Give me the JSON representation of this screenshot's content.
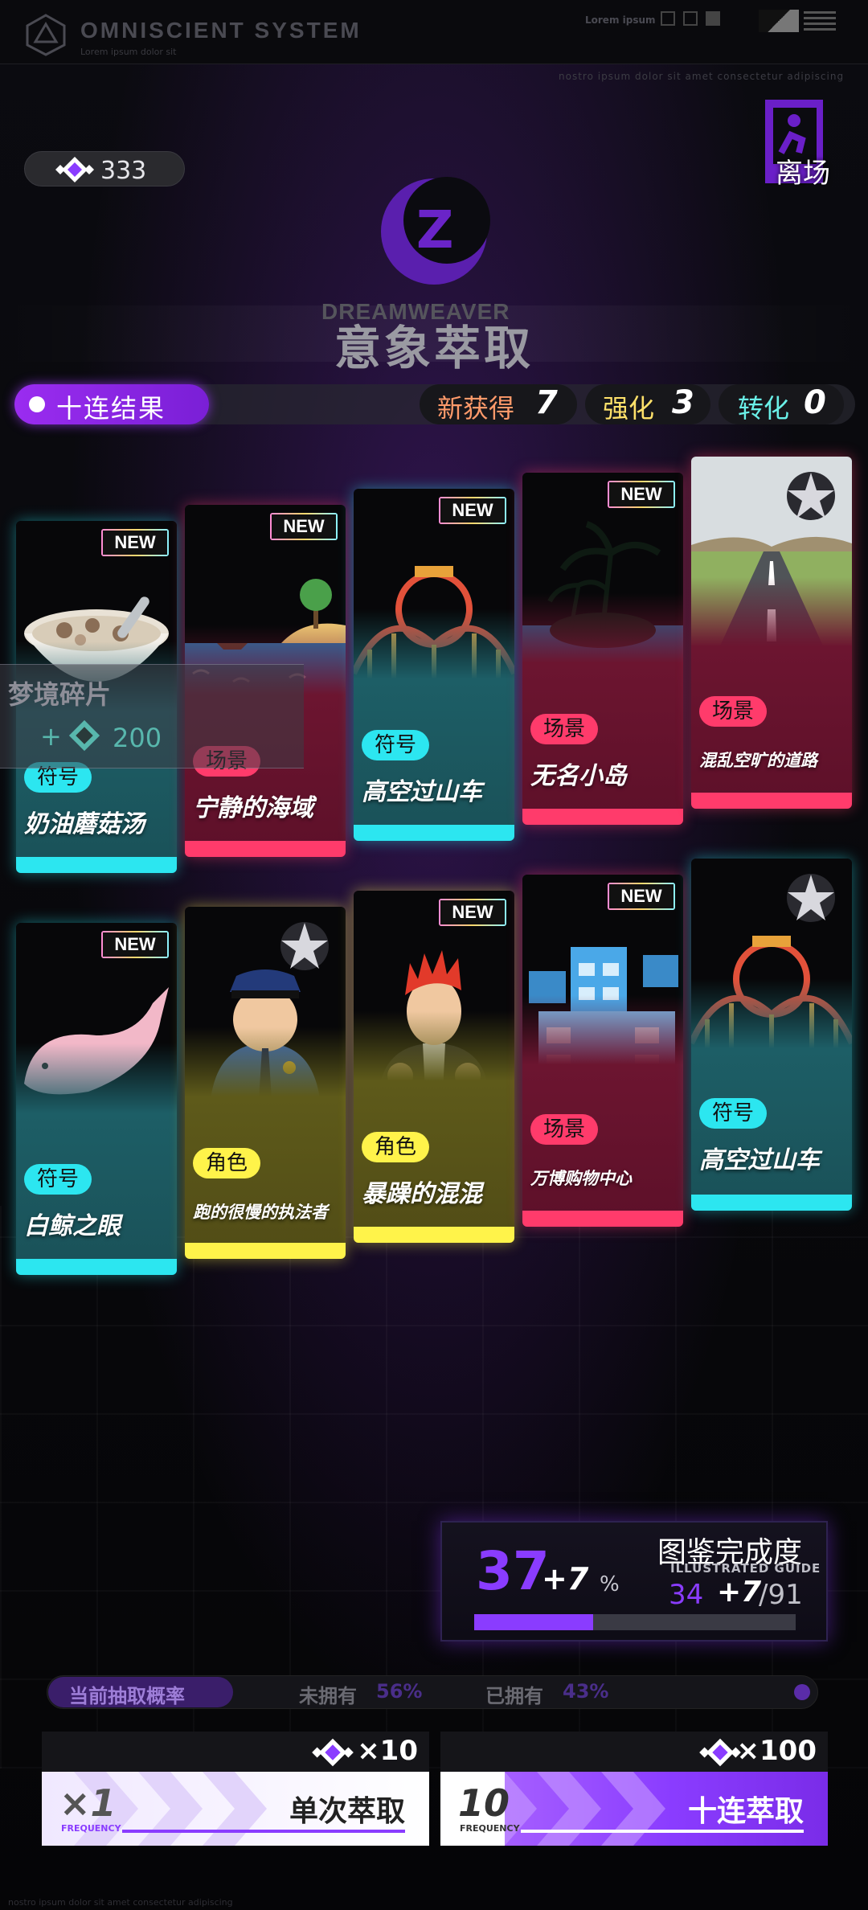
{
  "system": {
    "title": "OMNISCIENT  SYSTEM",
    "subtitle": "Lorem ipsum dolor sit",
    "lorem": "Lorem ipsum",
    "ticker": "nostro ipsum dolor sit amet consectetur adipiscing"
  },
  "currency": {
    "amount": "333",
    "icon": "dream-crystal-icon"
  },
  "exit": {
    "label": "离场",
    "icon": "exit-door-icon"
  },
  "emblem": {
    "brand": "DREAMWEAVER",
    "title": "意象萃取"
  },
  "results": {
    "label": "十连结果",
    "stats": [
      {
        "label": "新获得",
        "value": "7",
        "color": "#ff9a6a"
      },
      {
        "label": "强化",
        "value": "3",
        "color": "#ffe16a"
      },
      {
        "label": "转化",
        "value": "0",
        "color": "#6af0e8"
      }
    ]
  },
  "cards": [
    {
      "name": "奶油蘑菇汤",
      "tag": "符号",
      "theme": "teal",
      "badge": "NEW",
      "art": "mushroom-soup"
    },
    {
      "name": "宁静的海域",
      "tag": "场景",
      "theme": "red",
      "badge": "NEW",
      "art": "calm-sea"
    },
    {
      "name": "高空过山车",
      "tag": "符号",
      "theme": "teal",
      "badge": "NEW",
      "art": "roller-coaster"
    },
    {
      "name": "无名小岛",
      "tag": "场景",
      "theme": "red",
      "badge": "NEW",
      "art": "nameless-island"
    },
    {
      "name": "混乱空旷的道路",
      "tag": "场景",
      "theme": "red",
      "badge": "star",
      "art": "empty-road"
    },
    {
      "name": "白鲸之眼",
      "tag": "符号",
      "theme": "teal",
      "badge": "NEW",
      "art": "white-whale"
    },
    {
      "name": "跑的很慢的执法者",
      "tag": "角色",
      "theme": "yellow",
      "badge": "star",
      "art": "police-officer"
    },
    {
      "name": "暴躁的混混",
      "tag": "角色",
      "theme": "yellow",
      "badge": "NEW",
      "art": "punk"
    },
    {
      "name": "万博购物中心",
      "tag": "场景",
      "theme": "red",
      "badge": "NEW",
      "art": "shopping-mall"
    },
    {
      "name": "高空过山车",
      "tag": "符号",
      "theme": "teal",
      "badge": "star",
      "art": "roller-coaster"
    }
  ],
  "new_badge": "NEW",
  "fragment": {
    "title": "梦境碎片",
    "plus": "+",
    "amount": "200"
  },
  "guide": {
    "percent": "37",
    "percent_gain": "+7",
    "percent_sign": "%",
    "title": "图鉴完成度",
    "subtitle": "ILLUSTRATED GUIDE",
    "count": "34",
    "count_gain": "+7",
    "total": "/91",
    "progress": 0.37
  },
  "rate": {
    "label": "当前抽取概率",
    "unowned_label": "未拥有",
    "unowned_value": "56%",
    "owned_label": "已拥有",
    "owned_value": "43%"
  },
  "draws": [
    {
      "cost": "×10",
      "freq": "1",
      "freq_prefix": "×",
      "freq_label": "FREQUENCY",
      "label": "单次萃取"
    },
    {
      "cost": "×100",
      "freq": "10",
      "freq_prefix": "",
      "freq_label": "FREQUENCY",
      "label": "十连萃取"
    }
  ],
  "colors": {
    "accent": "#8a3cff",
    "teal": "#2ce6f0",
    "red": "#ff3b6b",
    "yellow": "#fff34a"
  }
}
